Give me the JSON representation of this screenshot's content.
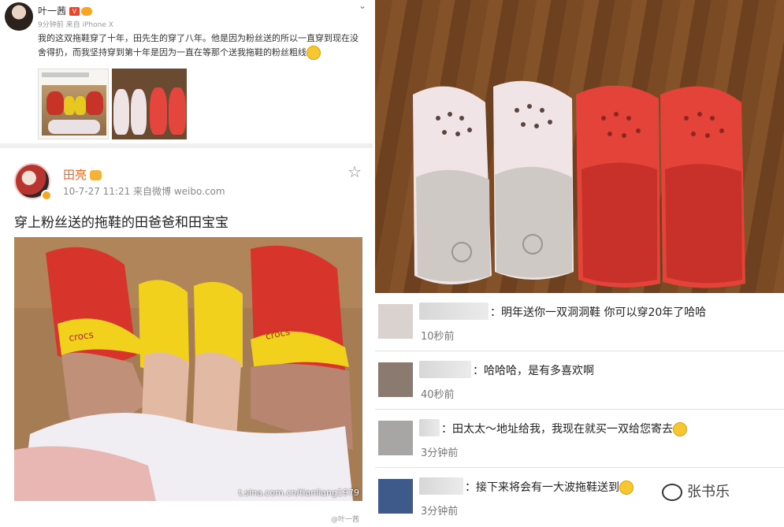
{
  "post1": {
    "author": "叶一茜",
    "meta": "9分钟前  来自 iPhone X",
    "text": "我的这双拖鞋穿了十年，田先生的穿了八年。他是因为粉丝送的所以一直穿到现在没舍得扔，而我坚持穿到第十年是因为一直在等那个送我拖鞋的粉丝粗线",
    "chevron": "⌄"
  },
  "post2": {
    "author": "田亮",
    "meta": "10-7-27 11:21  来自微博 weibo.com",
    "text": "穿上粉丝送的拖鞋的田爸爸和田宝宝",
    "watermark": "t.sina.com.cn/tianliang1979",
    "star": "☆",
    "crocs_label": "crocs"
  },
  "comments": [
    {
      "text": "：明年送你一双洞洞鞋  你可以穿20年了哈哈",
      "time": "10秒前"
    },
    {
      "text": "：哈哈哈，是有多喜欢啊",
      "time": "40秒前"
    },
    {
      "text": "：田太太～地址给我，我现在就买一双给您寄去",
      "time": "3分钟前"
    },
    {
      "text": "：接下来将会有一大波拖鞋送到",
      "time": "3分钟前"
    }
  ],
  "watermark": {
    "wechat_name": "张书乐",
    "bottom": "@叶一茜"
  },
  "colors": {
    "accent_orange": "#e36a2a",
    "crocs_red": "#d7352c",
    "crocs_yellow": "#f2d11d"
  }
}
